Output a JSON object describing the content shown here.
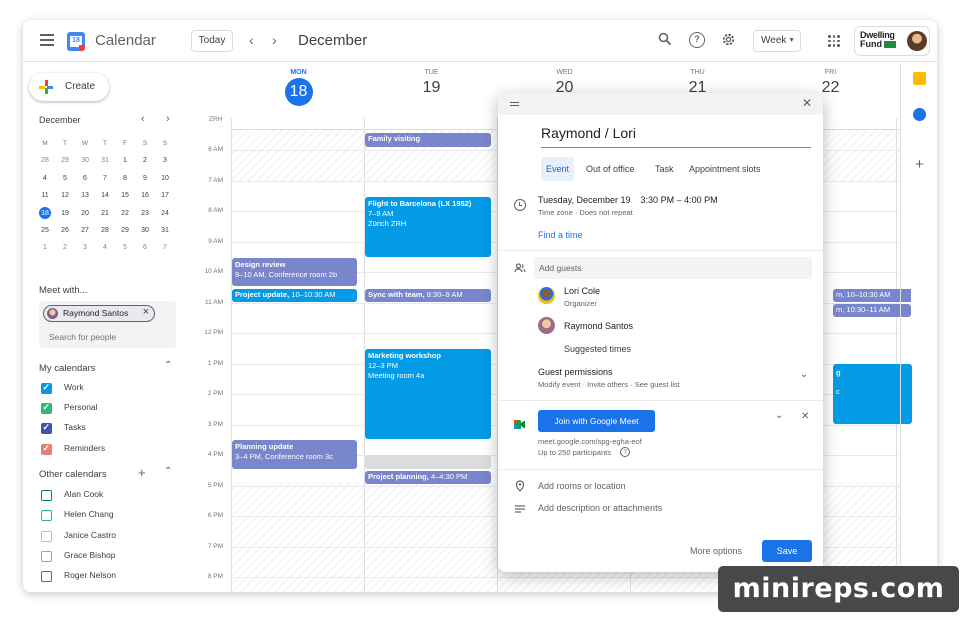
{
  "app": {
    "title": "Calendar",
    "logo_day": "18"
  },
  "header": {
    "today_label": "Today",
    "prev_icon": "chevron-left-icon",
    "next_icon": "chevron-right-icon",
    "month": "December",
    "view": "Week",
    "brand_line1": "Dwelling",
    "brand_line2": "Fund"
  },
  "sidebar": {
    "create_label": "Create",
    "mini_cal": {
      "month": "December",
      "dows": [
        "M",
        "T",
        "W",
        "T",
        "F",
        "S",
        "S"
      ],
      "weeks": [
        [
          "28",
          "29",
          "30",
          "31",
          "1",
          "2",
          "3"
        ],
        [
          "4",
          "5",
          "6",
          "7",
          "8",
          "9",
          "10"
        ],
        [
          "11",
          "12",
          "13",
          "14",
          "15",
          "16",
          "17"
        ],
        [
          "18",
          "19",
          "20",
          "21",
          "22",
          "23",
          "24"
        ],
        [
          "25",
          "26",
          "27",
          "28",
          "29",
          "30",
          "31"
        ],
        [
          "1",
          "2",
          "3",
          "4",
          "5",
          "6",
          "7"
        ]
      ],
      "today": "18"
    },
    "meet_with": {
      "label": "Meet with...",
      "chip": "Raymond Santos",
      "placeholder": "Search for people"
    },
    "my_calendars": {
      "label": "My calendars",
      "items": [
        {
          "name": "Work",
          "color": "#039be5",
          "checked": true
        },
        {
          "name": "Personal",
          "color": "#33b679",
          "checked": true
        },
        {
          "name": "Tasks",
          "color": "#3f51b5",
          "checked": true
        },
        {
          "name": "Reminders",
          "color": "#e67c73",
          "checked": true
        }
      ]
    },
    "other_calendars": {
      "label": "Other calendars",
      "items": [
        {
          "name": "Alan Cook",
          "color": "#0b8043"
        },
        {
          "name": "Helen Chang",
          "color": "#33b679"
        },
        {
          "name": "Janice Castro",
          "color": "#f6bf26"
        },
        {
          "name": "Grace Bishop",
          "color": "#4fc3c7"
        },
        {
          "name": "Roger Nelson",
          "color": "#1a73e8"
        }
      ]
    }
  },
  "week": {
    "days": [
      {
        "dow": "MON",
        "date": "18",
        "active": true
      },
      {
        "dow": "TUE",
        "date": "19"
      },
      {
        "dow": "WED",
        "date": "20"
      },
      {
        "dow": "THU",
        "date": "21"
      },
      {
        "dow": "FRI",
        "date": "22"
      }
    ],
    "timezone": "ZRH",
    "hours": [
      "6 AM",
      "7 AM",
      "8 AM",
      "9 AM",
      "10 AM",
      "11 AM",
      "12 PM",
      "1 PM",
      "2 PM",
      "3 PM",
      "4 PM",
      "5 PM",
      "6 PM",
      "7 PM",
      "8 PM"
    ],
    "events": {
      "family_visiting": "Family visiting",
      "design_review": {
        "title": "Design review",
        "detail": "9–10 AM, Conference room 2b"
      },
      "project_update": {
        "title": "Project update,",
        "detail": "10–10:30 AM"
      },
      "flight": {
        "title": "Flight to Barcelona (LX 1952)",
        "time": "7–9 AM",
        "place": "Zürich ZRH"
      },
      "sync_team": {
        "title": "Sync with team,",
        "detail": "8:30–9 AM"
      },
      "marketing": {
        "title": "Marketing workshop",
        "time": "12–3 PM",
        "place": "Meeting room 4a"
      },
      "planning_update": {
        "title": "Planning update",
        "detail": "3–4 PM, Conference room 3c"
      },
      "project_planning": {
        "title": "Project planning,",
        "detail": "4–4:30 PM"
      },
      "fri_1": "m, 10–10:30 AM",
      "fri_2": "m, 10:30–11 AM",
      "fri_3": "g",
      "fri_4": "c"
    }
  },
  "dialog": {
    "title": "Raymond / Lori",
    "tabs": [
      "Event",
      "Out of office",
      "Task",
      "Appointment slots"
    ],
    "active_tab": "Event",
    "date_line": "Tuesday, December 19    3:30 PM – 4:00 PM",
    "tz_line": "Time zone · Does not repeat",
    "find_time": "Find a time",
    "add_guests": "Add guests",
    "guests": [
      {
        "name": "Lori Cole",
        "role": "Organizer"
      },
      {
        "name": "Raymond Santos",
        "role": ""
      }
    ],
    "suggested_times": "Suggested times",
    "guest_permissions": "Guest permissions",
    "permissions_detail": "Modify event · Invite others · See guest list",
    "meet_button": "Join with Google Meet",
    "meet_url": "meet.google.com/spg-egha-eof",
    "meet_limit": "Up to 250 participants",
    "add_location": "Add rooms or location",
    "add_description": "Add description or attachments",
    "more_options": "More options",
    "save": "Save",
    "colors": {
      "primary": "#1a73e8",
      "event_purple": "#7986cb",
      "event_blue": "#039be5"
    }
  },
  "watermark": "minireps.com"
}
